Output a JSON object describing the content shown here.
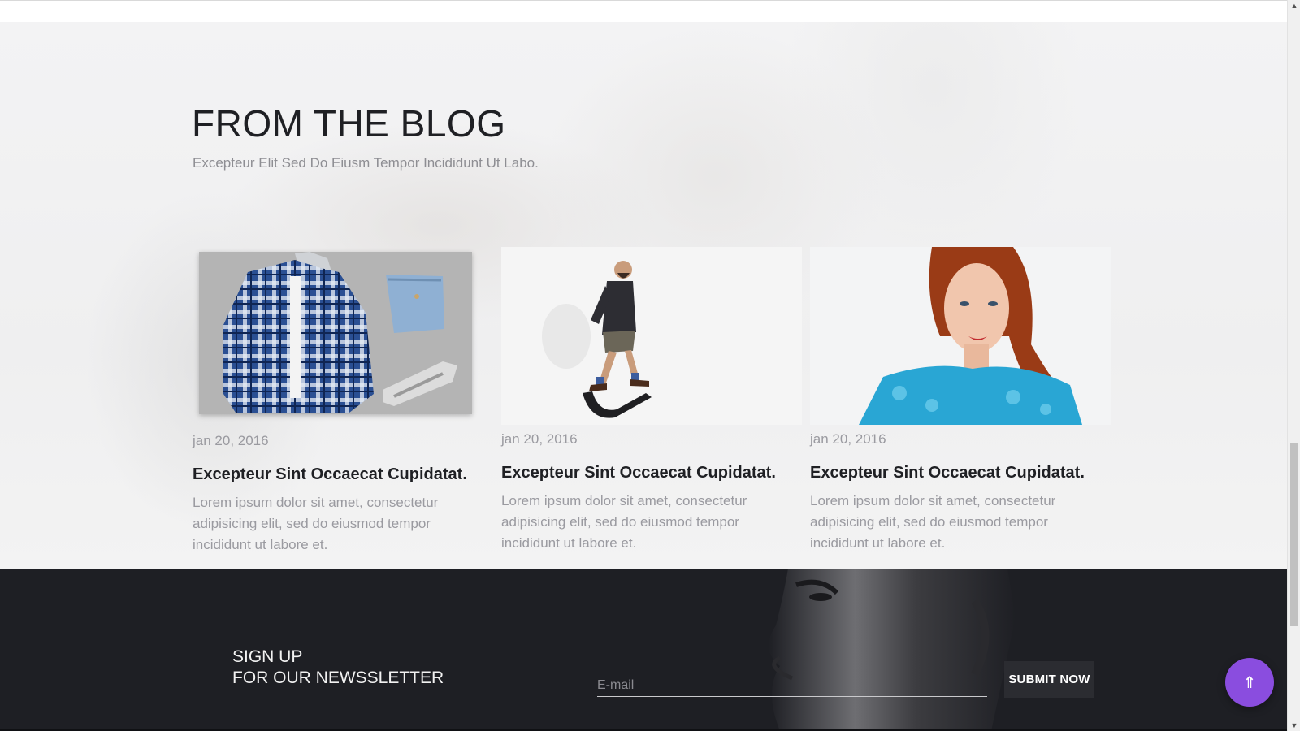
{
  "blog": {
    "title": "FROM THE BLOG",
    "subtitle": "Excepteur Elit Sed Do Eiusm Tempor Incididunt Ut Labo.",
    "posts": [
      {
        "date": "jan 20, 2016",
        "title": "Excepteur Sint Occaecat Cupidatat.",
        "excerpt": "Lorem ipsum dolor sit amet, consectetur adipisicing elit, sed do eiusmod tempor incididunt ut labore et.",
        "image": "flat-lay-clothing-image"
      },
      {
        "date": "jan 20, 2016",
        "title": "Excepteur Sint Occaecat Cupidatat.",
        "excerpt": "Lorem ipsum dolor sit amet, consectetur adipisicing elit, sed do eiusmod tempor incididunt ut labore et.",
        "image": "man-walking-image"
      },
      {
        "date": "jan 20, 2016",
        "title": "Excepteur Sint Occaecat Cupidatat.",
        "excerpt": "Lorem ipsum dolor sit amet, consectetur adipisicing elit, sed do eiusmod tempor incididunt ut labore et.",
        "image": "redhead-portrait-image"
      }
    ]
  },
  "newsletter": {
    "title_line1": "SIGN UP",
    "title_line2": "FOR OUR NEWSSLETTER",
    "email_placeholder": "E-mail",
    "submit_label": "SUBMIT NOW"
  },
  "back_to_top": {
    "icon": "double-up-arrow-icon",
    "glyph": "⇑"
  },
  "colors": {
    "accent": "#8a4ddf",
    "dark_bg": "#1e1f24",
    "heading": "#1f2024",
    "muted_text": "#9a9aa0"
  }
}
